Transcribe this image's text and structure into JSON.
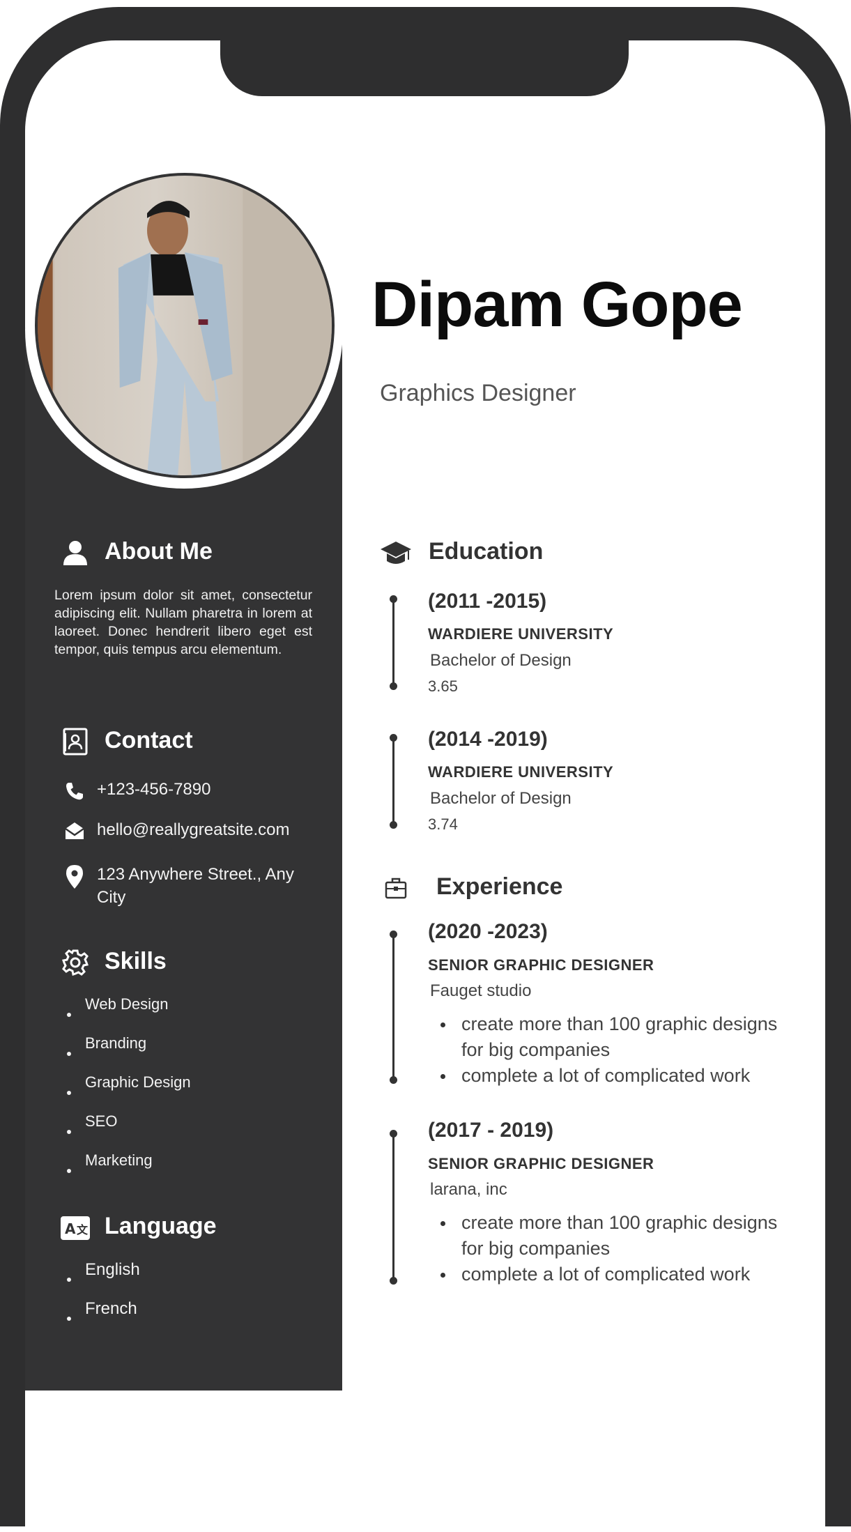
{
  "header": {
    "name": "Dipam Gope",
    "role": "Graphics Designer"
  },
  "about": {
    "heading": "About Me",
    "text": "Lorem ipsum dolor sit amet, consectetur adipiscing elit. Nullam pharetra in lorem at laoreet. Donec hendrerit libero eget est tempor, quis tempus arcu elementum."
  },
  "contact": {
    "heading": "Contact",
    "phone": "+123-456-7890",
    "email": "hello@reallygreatsite.com",
    "address_line1": "123 Anywhere Street., Any",
    "address_line2": "City"
  },
  "skills": {
    "heading": "Skills",
    "items": [
      "Web Design",
      "Branding",
      "Graphic Design",
      "SEO",
      "Marketing"
    ]
  },
  "language": {
    "heading": "Language",
    "items": [
      "English",
      "French"
    ]
  },
  "education": {
    "heading": "Education",
    "entries": [
      {
        "years": "(2011 -2015)",
        "school": "WARDIERE UNIVERSITY",
        "degree": "Bachelor of Design",
        "gpa": "3.65"
      },
      {
        "years": "(2014 -2019)",
        "school": "WARDIERE UNIVERSITY",
        "degree": "Bachelor of Design",
        "gpa": "3.74"
      }
    ]
  },
  "experience": {
    "heading": "Experience",
    "entries": [
      {
        "years": "(2020 -2023)",
        "title": "SENIOR GRAPHIC DESIGNER",
        "company": "Fauget studio",
        "bullets": [
          "create more than 100 graphic designs for big companies",
          "complete a lot of complicated work"
        ]
      },
      {
        "years": "(2017 - 2019)",
        "title": "SENIOR GRAPHIC DESIGNER",
        "company": "larana, inc",
        "bullets": [
          "create more than 100 graphic designs for big companies",
          "complete a lot of complicated work"
        ]
      }
    ]
  },
  "colors": {
    "frame": "#2e2e2f",
    "sidebar": "#333334",
    "text_dark": "#333333"
  }
}
